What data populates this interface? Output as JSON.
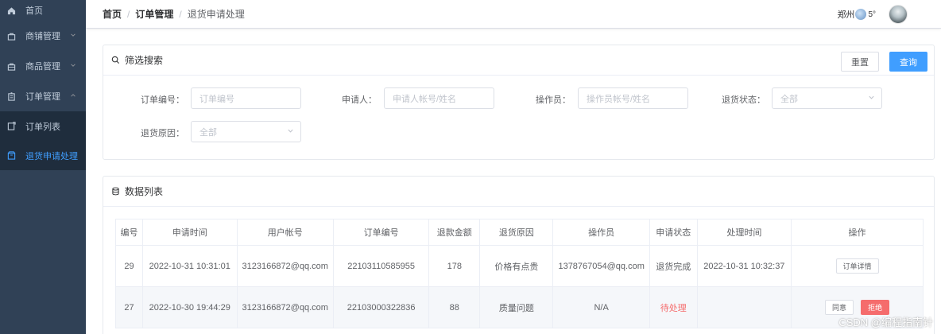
{
  "sidebar": {
    "items": [
      {
        "label": "首页",
        "icon": "home-icon"
      },
      {
        "label": "商铺管理",
        "icon": "store-icon",
        "arrow": "chevron-down"
      },
      {
        "label": "商品管理",
        "icon": "goods-icon",
        "arrow": "chevron-down"
      },
      {
        "label": "订单管理",
        "icon": "order-icon",
        "arrow": "chevron-up"
      }
    ],
    "submenu": [
      {
        "label": "订单列表",
        "icon": "list-icon",
        "active": false
      },
      {
        "label": "退货申请处理",
        "icon": "return-icon",
        "active": true
      }
    ]
  },
  "breadcrumb": {
    "home": "首页",
    "sep1": "/",
    "order": "订单管理",
    "sep2": "/",
    "current": "退货申请处理"
  },
  "header": {
    "city": "郑州",
    "temp": "5°"
  },
  "filter": {
    "title": "筛选搜索",
    "reset_label": "重置",
    "search_label": "查询",
    "fields": {
      "order_no_label": "订单编号：",
      "order_no_placeholder": "订单编号",
      "applicant_label": "申请人：",
      "applicant_placeholder": "申请人帐号/姓名",
      "operator_label": "操作员：",
      "operator_placeholder": "操作员帐号/姓名",
      "status_label": "退货状态：",
      "status_value": "全部",
      "reason_label": "退货原因：",
      "reason_value": "全部"
    }
  },
  "table": {
    "title": "数据列表",
    "columns": [
      "编号",
      "申请时间",
      "用户帐号",
      "订单编号",
      "退款金额",
      "退货原因",
      "操作员",
      "申请状态",
      "处理时间",
      "操作"
    ],
    "rows": [
      {
        "id": "29",
        "apply_time": "2022-10-31 10:31:01",
        "user": "3123166872@qq.com",
        "order_no": "22103110585955",
        "amount": "178",
        "reason": "价格有点贵",
        "operator": "1378767054@qq.com",
        "status": "退货完成",
        "process_time": "2022-10-31 10:32:37",
        "actions": {
          "detail": "订单详情"
        }
      },
      {
        "id": "27",
        "apply_time": "2022-10-30 19:44:29",
        "user": "3123166872@qq.com",
        "order_no": "22103000322836",
        "amount": "88",
        "reason": "质量问题",
        "operator": "N/A",
        "status": "待处理",
        "process_time": "",
        "actions": {
          "approve": "同意",
          "reject": "拒绝"
        }
      }
    ]
  },
  "watermark": "CSDN @编程指南针",
  "colors": {
    "sidebar_bg": "#304156",
    "submenu_bg": "#1f2d3d",
    "primary": "#409eff",
    "danger": "#f56c6c"
  }
}
